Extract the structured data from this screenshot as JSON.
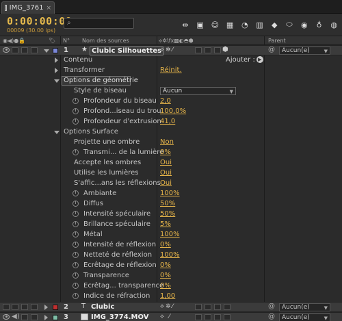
{
  "tab": {
    "label": "IMG_3761"
  },
  "header": {
    "timecode": "0:00:00:09",
    "frame_info": "00009 (30.00 ips)",
    "search_placeholder": ""
  },
  "columns": {
    "num": "N°",
    "source": "Nom des sources",
    "parent": "Parent"
  },
  "layers": [
    {
      "num": "1",
      "name": "Clubic Silhouettes",
      "color": "#7b87d8",
      "parent": "Aucun(e)"
    },
    {
      "num": "2",
      "name": "Clubic",
      "color": "#c03030",
      "parent": "Aucun(e)"
    },
    {
      "num": "3",
      "name": "IMG_3774.MOV",
      "color": "#7fbfa8",
      "parent": "Aucun(e)"
    }
  ],
  "groups": {
    "contenu": "Contenu",
    "ajouter": "Ajouter :",
    "transformer": "Transformer",
    "reinit": "Réinit.",
    "options_geometrie": "Options de géométrie",
    "options_surface": "Options Surface"
  },
  "geometry": [
    {
      "label": "Style de biseau",
      "value": "Aucun",
      "type": "dropdown"
    },
    {
      "label": "Profondeur du biseau",
      "value": "2,0"
    },
    {
      "label": "Profond...iseau du trou",
      "value": "100,0%"
    },
    {
      "label": "Profondeur d'extrusion",
      "value": "41,0"
    }
  ],
  "surface": [
    {
      "label": "Projette une ombre",
      "value": "Non",
      "sw": false
    },
    {
      "label": "Transmi... de la lumière",
      "value": "0%",
      "sw": true
    },
    {
      "label": "Accepte les ombres",
      "value": "Oui",
      "sw": false
    },
    {
      "label": "Utilise les lumières",
      "value": "Oui",
      "sw": false
    },
    {
      "label": "S'affic...ans les réflexions",
      "value": "Oui",
      "sw": false
    },
    {
      "label": "Ambiante",
      "value": "100%",
      "sw": true
    },
    {
      "label": "Diffus",
      "value": "50%",
      "sw": true
    },
    {
      "label": "Intensité spéculaire",
      "value": "50%",
      "sw": true
    },
    {
      "label": "Brillance spéculaire",
      "value": "5%",
      "sw": true
    },
    {
      "label": "Métal",
      "value": "100%",
      "sw": true
    },
    {
      "label": "Intensité de réflexion",
      "value": "0%",
      "sw": true
    },
    {
      "label": "Netteté de réflexion",
      "value": "100%",
      "sw": true
    },
    {
      "label": "Ecrêtage de réflexion",
      "value": "0%",
      "sw": true
    },
    {
      "label": "Transparence",
      "value": "0%",
      "sw": true
    },
    {
      "label": "Ecrêtag... transparence",
      "value": "0%",
      "sw": true
    },
    {
      "label": "Indice de réfraction",
      "value": "1,00",
      "sw": true
    }
  ],
  "colors": {
    "accent": "#e8b64a",
    "panel": "#2b2b2b"
  }
}
